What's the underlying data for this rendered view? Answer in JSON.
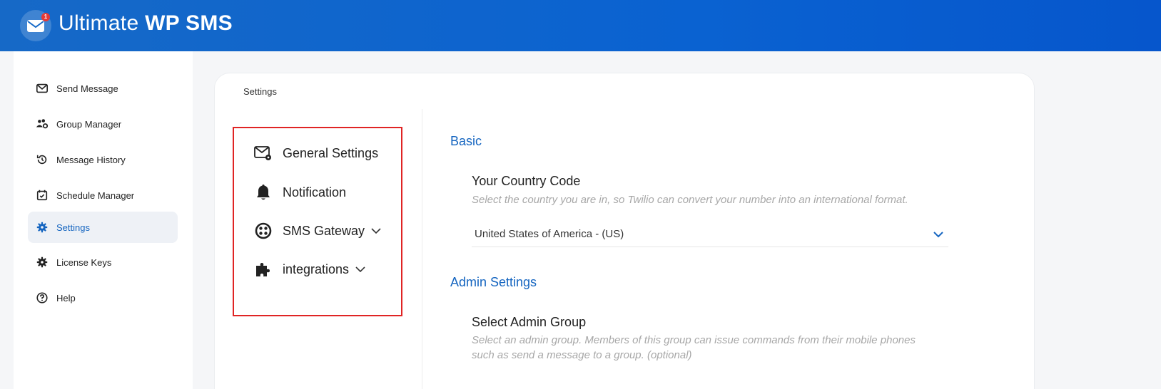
{
  "header": {
    "brand_light": "Ultimate ",
    "brand_bold": "WP SMS",
    "badge": "1"
  },
  "sidebar": {
    "items": [
      {
        "label": "Send Message",
        "icon": "envelope-icon"
      },
      {
        "label": "Group Manager",
        "icon": "users-gear-icon"
      },
      {
        "label": "Message History",
        "icon": "history-icon"
      },
      {
        "label": "Schedule Manager",
        "icon": "calendar-check-icon"
      },
      {
        "label": "Settings",
        "icon": "gear-icon",
        "active": true
      },
      {
        "label": "License Keys",
        "icon": "gear-icon"
      },
      {
        "label": "Help",
        "icon": "question-circle-icon"
      }
    ]
  },
  "card": {
    "breadcrumb": "Settings",
    "subnav": [
      {
        "label": "General Settings",
        "icon": "envelope-gear-icon"
      },
      {
        "label": "Notification",
        "icon": "bell-icon"
      },
      {
        "label": "SMS Gateway",
        "icon": "twilio-icon",
        "expandable": true
      },
      {
        "label": "integrations",
        "icon": "puzzle-icon",
        "expandable": true
      }
    ],
    "basic": {
      "title": "Basic",
      "country_label": "Your Country Code",
      "country_help": "Select the country you are in, so Twilio can convert your number into an international format.",
      "country_value": "United States of America - (US)"
    },
    "admin": {
      "title": "Admin Settings",
      "group_label": "Select Admin Group",
      "group_help": "Select an admin group. Members of this group can issue commands from their mobile phones such as send a message to a group. (optional)"
    }
  },
  "colors": {
    "accent": "#1565c0",
    "header": "#0a62d1",
    "highlight_border": "#e02424"
  }
}
